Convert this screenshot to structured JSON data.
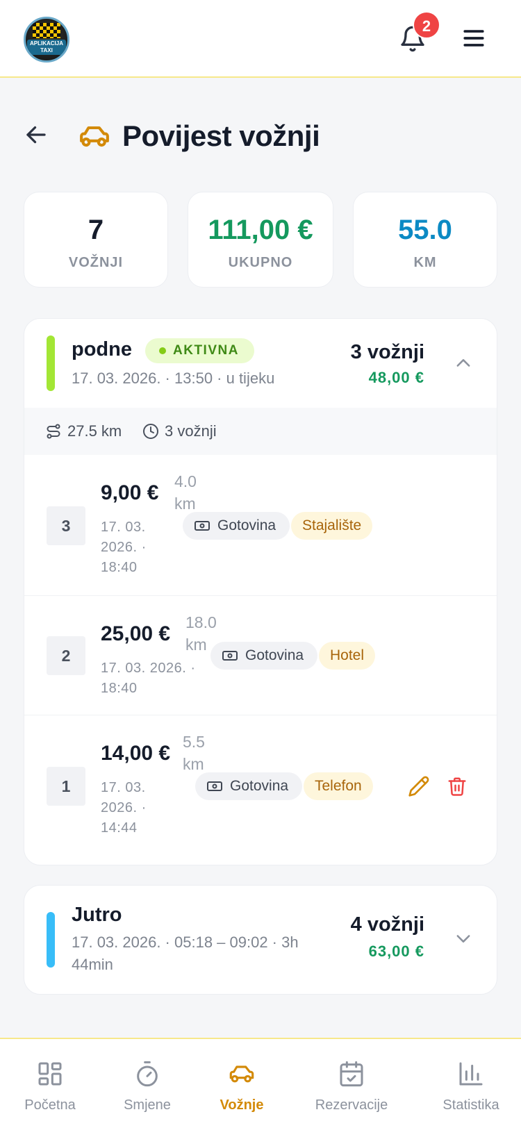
{
  "header": {
    "logo_text": "APLIKACIJA TAXI",
    "notifications_count": "2"
  },
  "page": {
    "title": "Povijest vožnji"
  },
  "stats": [
    {
      "value": "7",
      "label": "VOŽNJI",
      "color": "#151c2b"
    },
    {
      "value": "111,00 €",
      "label": "UKUPNO",
      "color": "#15995e"
    },
    {
      "value": "55.0",
      "label": "KM",
      "color": "#0c8ac4"
    }
  ],
  "shifts": [
    {
      "name": "podne",
      "status": "AKTIVNA",
      "subtitle": "17. 03. 2026. · 13:50 · u tijeku",
      "rides_count": "3 vožnji",
      "total": "48,00 €",
      "accent": "#84cc16",
      "expanded": true,
      "summary": {
        "km": "27.5 km",
        "rides": "3 vožnji"
      },
      "rides": [
        {
          "number": "3",
          "price": "9,00 €",
          "km": "4.0 km",
          "date": "17. 03. 2026. · 18:40",
          "payment": "Gotovina",
          "source": "Stajalište"
        },
        {
          "number": "2",
          "price": "25,00 €",
          "km": "18.0 km",
          "date": "17. 03. 2026. · 18:40",
          "payment": "Gotovina",
          "source": "Hotel"
        },
        {
          "number": "1",
          "price": "14,00 €",
          "km": "5.5 km",
          "date": "17. 03. 2026. · 14:44",
          "payment": "Gotovina",
          "source": "Telefon"
        }
      ]
    },
    {
      "name": "Jutro",
      "subtitle": "17. 03. 2026. · 05:18 – 09:02 · 3h 44min",
      "rides_count": "4 vožnji",
      "total": "63,00 €",
      "accent": "#38bdf8",
      "expanded": false
    }
  ],
  "nav": [
    {
      "label": "Početna",
      "icon": "dashboard-icon",
      "active": false
    },
    {
      "label": "Smjene",
      "icon": "stopwatch-icon",
      "active": false
    },
    {
      "label": "Vožnje",
      "icon": "car-icon",
      "active": true
    },
    {
      "label": "Rezervacije",
      "icon": "calendar-check-icon",
      "active": false
    },
    {
      "label": "Statistika",
      "icon": "bar-chart-icon",
      "active": false
    }
  ]
}
